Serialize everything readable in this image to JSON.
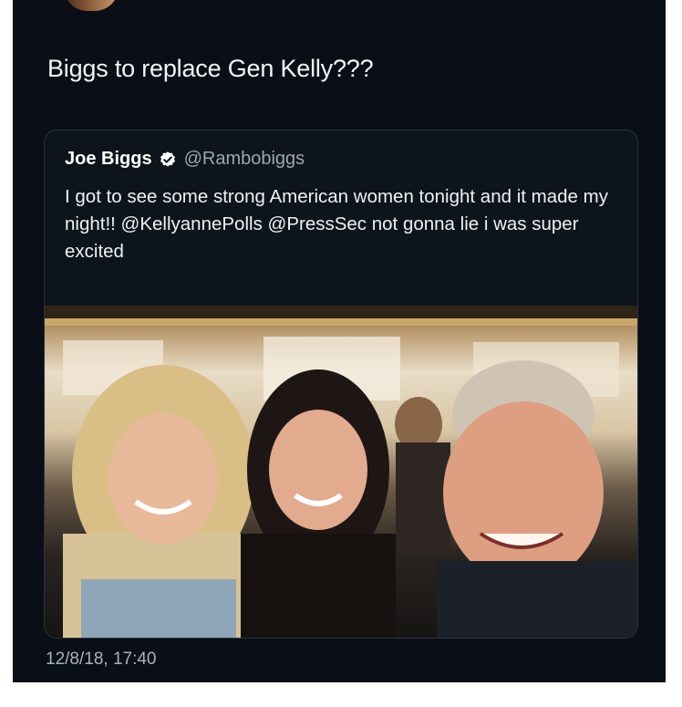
{
  "tweet": {
    "text": "Biggs to replace Gen Kelly???",
    "timestamp": "12/8/18, 17:40"
  },
  "quoted_tweet": {
    "display_name": "Joe Biggs",
    "handle": "@Rambobiggs",
    "verified_icon": "verified-badge-icon",
    "text": "I got to see some strong American women tonight and it made my night!! @KellyannePolls @PressSec not gonna lie i was super excited"
  },
  "colors": {
    "background": "#0a0f17",
    "text": "#f2f4f6",
    "secondary_text": "#9ba6b2",
    "border": "#2a3340"
  }
}
